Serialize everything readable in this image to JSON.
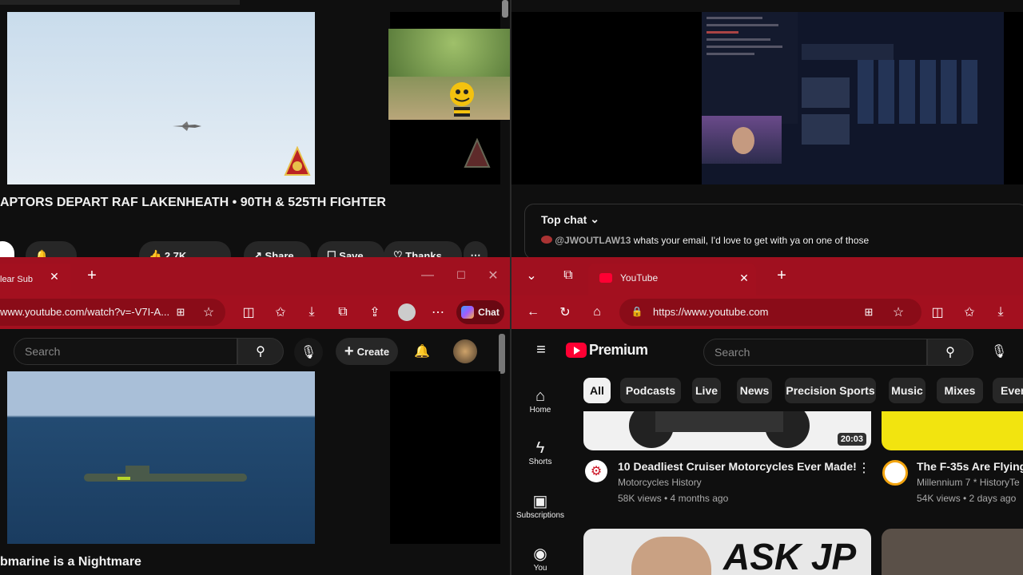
{
  "top_left": {
    "video_title": "APTORS DEPART RAF LAKENHEATH • 90TH & 525TH FIGHTER",
    "like_count": "2.7K",
    "share_label": "Share",
    "save_label": "Save",
    "thanks_label": "Thanks"
  },
  "top_right": {
    "top_chat_label": "Top chat",
    "chat_author": "@JWOUTLAW13",
    "chat_message": "whats your email, I'd love to get with ya on one of those"
  },
  "bottom_left": {
    "tab_title": "lear Sub",
    "url": "www.youtube.com/watch?v=-V7I-A...",
    "chat_label": "Chat",
    "search_placeholder": "Search",
    "create_label": "Create",
    "video_title": "bmarine is a Nightmare"
  },
  "bottom_right": {
    "tab_title": "YouTube",
    "url": "https://www.youtube.com",
    "logo_text": "Premium",
    "search_placeholder": "Search",
    "chips": [
      "All",
      "Podcasts",
      "Live",
      "News",
      "Precision Sports",
      "Music",
      "Mixes",
      "Every"
    ],
    "nav": [
      {
        "label": "Home",
        "icon": "home-icon"
      },
      {
        "label": "Shorts",
        "icon": "shorts-icon"
      },
      {
        "label": "Subscriptions",
        "icon": "subscriptions-icon"
      },
      {
        "label": "You",
        "icon": "you-icon"
      }
    ],
    "videos": [
      {
        "title": "10 Deadliest Cruiser Motorcycles Ever Made!",
        "channel": "Motorcycles History",
        "meta": "58K views • 4 months ago",
        "duration": "20:03"
      },
      {
        "title": "The F-35s Are Flying",
        "channel": "Millennium 7 * HistoryTe",
        "meta": "54K views • 2 days ago",
        "duration": ""
      }
    ],
    "thumb_text": "ASK JP"
  },
  "colors": {
    "edge_red": "#a0101f",
    "yt_bg": "#0f0f0f",
    "chip_bg": "#272727",
    "accent": "#ff0033"
  }
}
